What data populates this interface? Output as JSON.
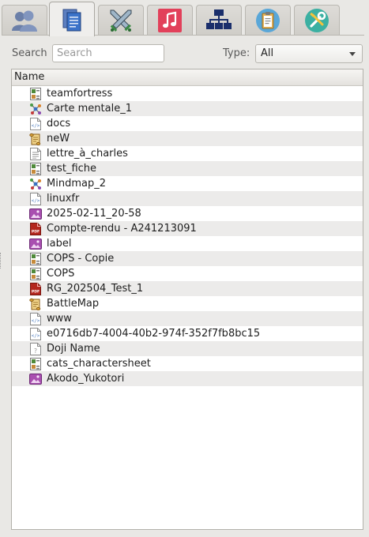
{
  "tabs": [
    {
      "icon": "users-icon",
      "active": false
    },
    {
      "icon": "documents-icon",
      "active": true
    },
    {
      "icon": "crossed-swords-icon",
      "active": false
    },
    {
      "icon": "music-icon",
      "active": false
    },
    {
      "icon": "network-icon",
      "active": false
    },
    {
      "icon": "clipboard-icon",
      "active": false
    },
    {
      "icon": "tools-icon",
      "active": false
    }
  ],
  "filter": {
    "search_label": "Search",
    "search_value": "",
    "search_placeholder": "Search",
    "type_label": "Type:",
    "type_value": "All"
  },
  "list": {
    "header": "Name",
    "items": [
      {
        "name": "teamfortress",
        "icon": "character-sheet-icon"
      },
      {
        "name": "Carte mentale_1",
        "icon": "mindmap-icon"
      },
      {
        "name": "docs",
        "icon": "web-file-icon"
      },
      {
        "name": "neW",
        "icon": "scroll-icon"
      },
      {
        "name": "lettre_à_charles",
        "icon": "text-file-icon"
      },
      {
        "name": "test_fiche",
        "icon": "character-sheet-icon"
      },
      {
        "name": "Mindmap_2",
        "icon": "mindmap-icon"
      },
      {
        "name": "linuxfr",
        "icon": "web-file-icon"
      },
      {
        "name": "2025-02-11_20-58",
        "icon": "image-file-icon"
      },
      {
        "name": "Compte-rendu - A241213091",
        "icon": "pdf-file-icon"
      },
      {
        "name": "label",
        "icon": "image-file-icon"
      },
      {
        "name": "COPS - Copie",
        "icon": "character-sheet-icon"
      },
      {
        "name": "COPS",
        "icon": "character-sheet-icon"
      },
      {
        "name": "RG_202504_Test_1",
        "icon": "pdf-file-icon"
      },
      {
        "name": "BattleMap",
        "icon": "scroll-icon"
      },
      {
        "name": "www",
        "icon": "web-file-icon"
      },
      {
        "name": "e0716db7-4004-40b2-974f-352f7fb8bc15",
        "icon": "web-file-icon"
      },
      {
        "name": "Doji Name",
        "icon": "unknown-file-icon"
      },
      {
        "name": "cats_charactersheet",
        "icon": "character-sheet-icon"
      },
      {
        "name": "Akodo_Yukotori",
        "icon": "image-file-icon"
      }
    ]
  },
  "colors": {
    "image_icon": "#a94fb0",
    "pdf_icon": "#b3261e",
    "web_icon": "#5a86c5",
    "sheet_icon": "#4f8a3a",
    "scroll_icon": "#d9a23a"
  }
}
